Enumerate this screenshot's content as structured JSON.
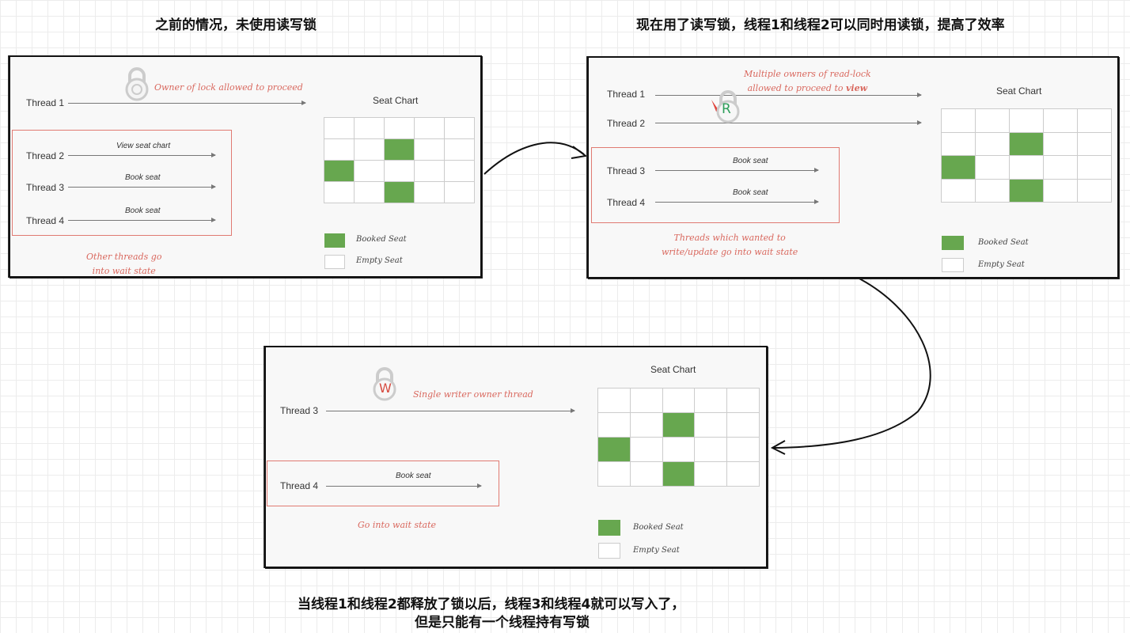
{
  "captions": {
    "before": "之前的情况，未使用读写锁",
    "after_read": "现在用了读写锁，线程1和线程2可以同时用读锁，提高了效率",
    "after_write_line1": "当线程1和线程2都释放了锁以后，线程3和线程4就可以写入了，",
    "after_write_line2": "但是只能有一个线程持有写锁"
  },
  "panel1": {
    "threads": [
      "Thread 1",
      "Thread 2",
      "Thread 3",
      "Thread 4"
    ],
    "ops": [
      "View seat chart",
      "Book seat",
      "Book seat"
    ],
    "owner_note": "Owner of lock allowed to proceed",
    "wait_note_line1": "Other threads go",
    "wait_note_line2": "into wait state",
    "seat_title": "Seat Chart",
    "legend_booked": "Booked Seat",
    "legend_empty": "Empty Seat"
  },
  "panel2": {
    "threads": [
      "Thread 1",
      "Thread 2",
      "Thread 3",
      "Thread 4"
    ],
    "ops": [
      "Book seat",
      "Book seat"
    ],
    "owner_note_line1": "Multiple owners of read-lock",
    "owner_note_line2_a": "allowed to proceed to ",
    "owner_note_line2_b": "view",
    "lock_letter": "R",
    "wait_note_line1": "Threads which wanted to",
    "wait_note_line2": "write/update go into wait state",
    "seat_title": "Seat Chart",
    "legend_booked": "Booked Seat",
    "legend_empty": "Empty Seat"
  },
  "panel3": {
    "threads": [
      "Thread 3",
      "Thread 4"
    ],
    "ops": [
      "Book seat"
    ],
    "owner_note": "Single writer owner thread",
    "lock_letter": "W",
    "wait_note": "Go into wait state",
    "seat_title": "Seat Chart",
    "legend_booked": "Booked Seat",
    "legend_empty": "Empty Seat"
  },
  "seat_chart": {
    "rows": 4,
    "cols": 5,
    "booked": [
      [
        1,
        2
      ],
      [
        2,
        0
      ],
      [
        3,
        2
      ]
    ]
  },
  "colors": {
    "booked": "#67a74f",
    "note": "#d9685e",
    "read_lock": "#2e9e5a",
    "write_lock": "#d64a3f"
  },
  "icons": {
    "lock": "padlock-icon",
    "read_lock": "read-lock-icon",
    "write_lock": "write-lock-icon"
  }
}
